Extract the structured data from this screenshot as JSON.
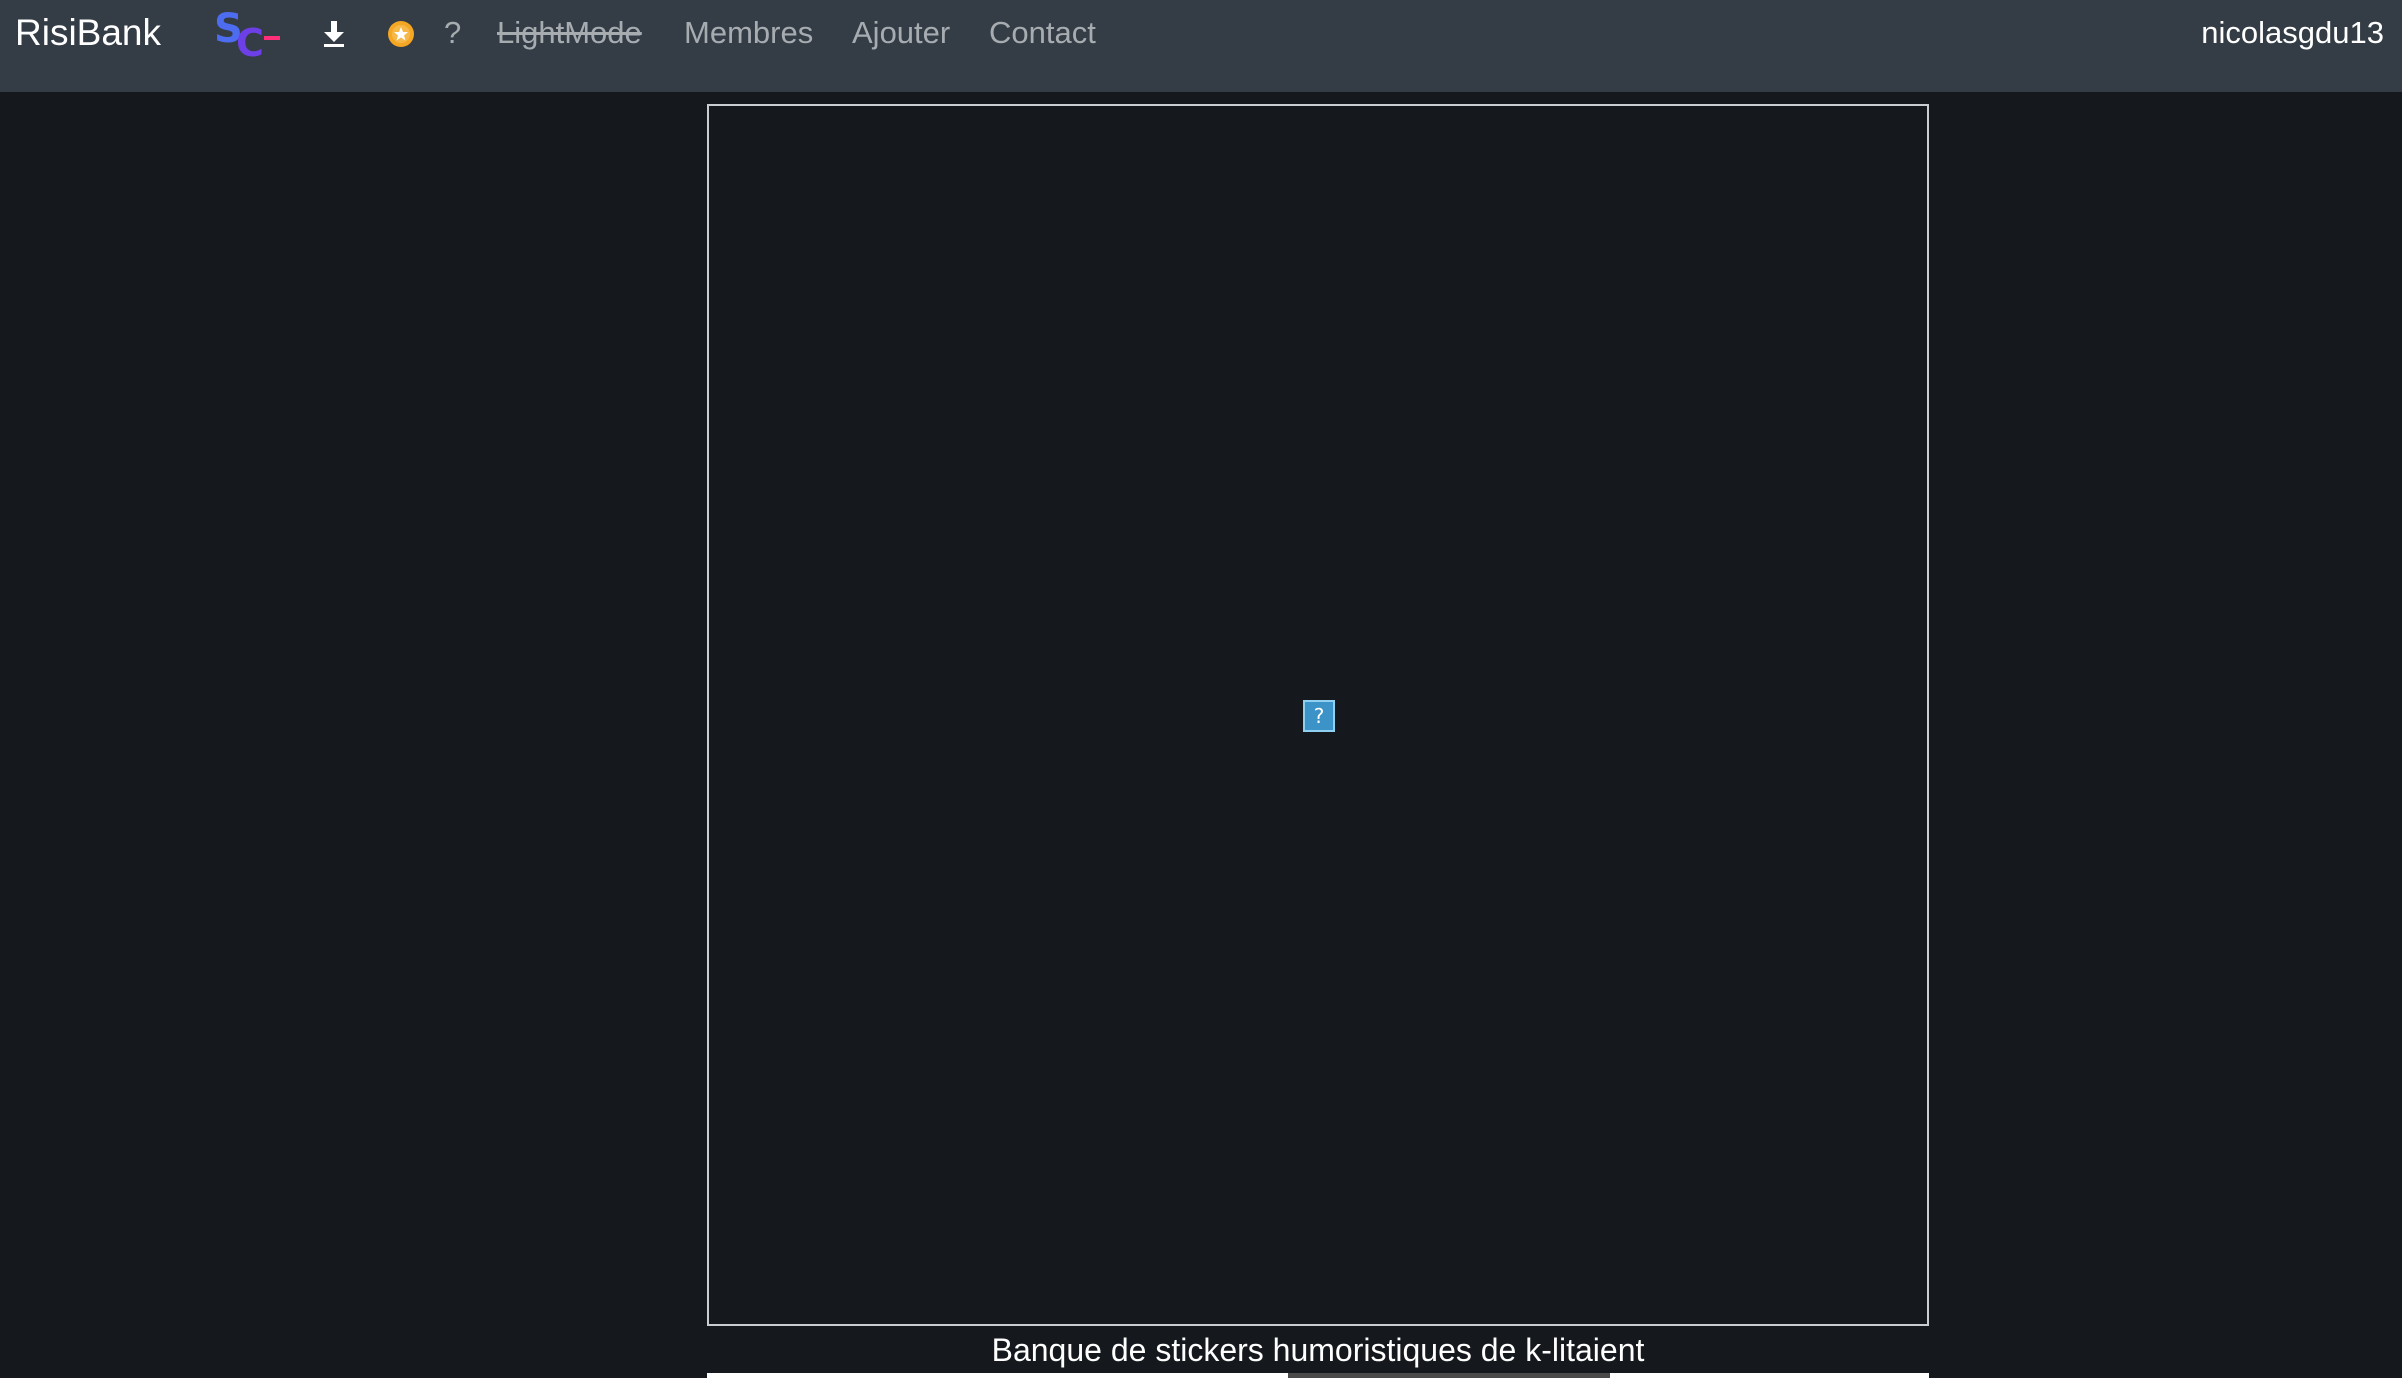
{
  "navbar": {
    "brand": "RisiBank",
    "logo_icon": "sc-logo-icon",
    "download_icon": "download-icon",
    "coin_icon": "star-coin-icon",
    "help_label": "?",
    "links": {
      "lightmode": "LightMode",
      "membres": "Membres",
      "ajouter": "Ajouter",
      "contact": "Contact"
    },
    "username": "nicolasgdu13"
  },
  "main": {
    "broken_image_glyph": "?",
    "caption": "Banque de stickers humoristiques de k-litaient"
  },
  "colors": {
    "navbar_bg": "#343d45",
    "page_bg": "#15181c",
    "link_muted": "#a7acb1",
    "logo_blue": "#4d5ef0",
    "logo_pink": "#ff2f7a",
    "coin_orange": "#f5a623"
  }
}
